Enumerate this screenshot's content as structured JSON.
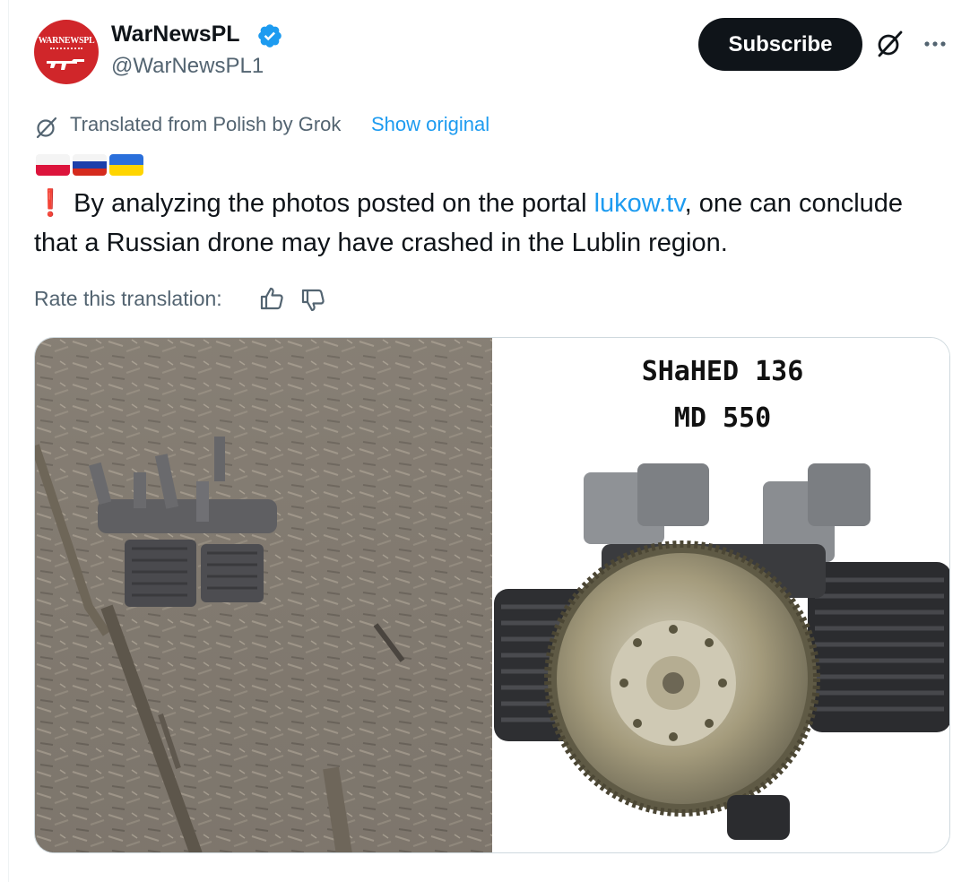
{
  "author": {
    "display_name": "WarNewsPL",
    "handle": "@WarNewsPL1",
    "avatar_text": "WARNEWSPL",
    "verified": true
  },
  "header": {
    "subscribe_label": "Subscribe",
    "grok_icon": "grok-icon",
    "more_icon": "more-icon"
  },
  "translation": {
    "icon": "grok-translate-icon",
    "text": "Translated from Polish by Grok",
    "show_original": "Show original"
  },
  "flags": [
    "Poland",
    "Russia",
    "Ukraine"
  ],
  "tweet": {
    "exclaim": "❗",
    "text_before_link": " By analyzing the photos posted on the portal ",
    "link_text": "lukow.tv",
    "text_after_link": ", one can conclude that a Russian drone may have crashed in the Lublin region."
  },
  "rate": {
    "label": "Rate this translation:",
    "up_icon": "thumb-up-icon",
    "down_icon": "thumb-down-icon"
  },
  "media": {
    "right_caption_line1": "SHaHED 136",
    "right_caption_line2": "MD 550"
  },
  "colors": {
    "link": "#1d9bf0",
    "text": "#0f1419",
    "secondary": "#536471",
    "button_bg": "#0f1419",
    "avatar_red": "#d0262a",
    "exclaim_red": "#e0252b"
  }
}
